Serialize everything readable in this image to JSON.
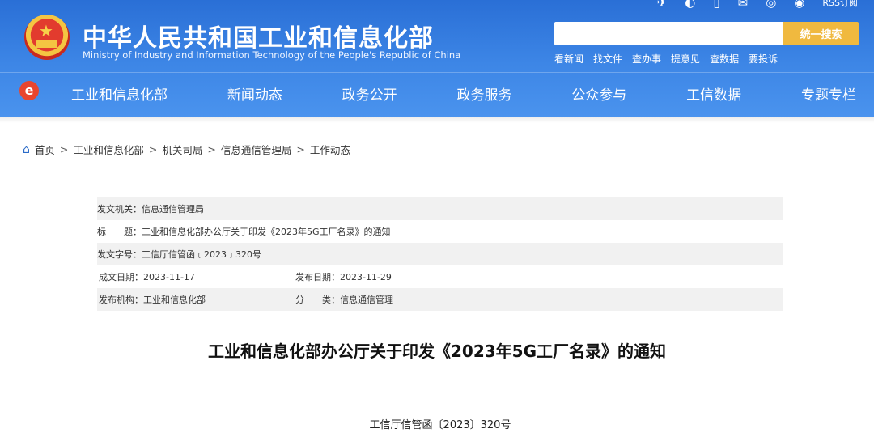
{
  "header": {
    "title": "中华人民共和国工业和信息化部",
    "subtitle": "Ministry of Industry and Information Technology of the People's Republic of China",
    "top_icons": [
      "weibo-icon",
      "wechat-icon",
      "mobile-icon",
      "mail-icon",
      "chat-icon",
      "rss-icon"
    ],
    "rss_label": "RSS订阅",
    "search": {
      "placeholder": "",
      "button": "统一搜索"
    },
    "quick_links": [
      "看新闻",
      "找文件",
      "查办事",
      "提意见",
      "查数据",
      "要投诉"
    ]
  },
  "nav": {
    "logo": "e",
    "items": [
      "工业和信息化部",
      "新闻动态",
      "政务公开",
      "政务服务",
      "公众参与",
      "工信数据",
      "专题专栏"
    ]
  },
  "breadcrumb": [
    "首页",
    "工业和信息化部",
    "机关司局",
    "信息通信管理局",
    "工作动态"
  ],
  "breadcrumb_sep": ">",
  "meta": {
    "issuer_label": "发文机关：",
    "issuer": "信息通信管理局",
    "title_label": "标　　题：",
    "title": "工业和信息化部办公厅关于印发《2023年5G工厂名录》的通知",
    "docno_label": "发文字号：",
    "docno": "工信厅信管函﹝2023﹞320号",
    "created_label": "成文日期：",
    "created": "2023-11-17",
    "published_label": "发布日期：",
    "published": "2023-11-29",
    "org_label": "发布机构：",
    "org": "工业和信息化部",
    "category_label": "分　　类：",
    "category": "信息通信管理"
  },
  "article": {
    "title": "工业和信息化部办公厅关于印发《2023年5G工厂名录》的通知",
    "doc_number": "工信厅信管函〔2023〕320号"
  },
  "colors": {
    "banner": "#3d86e6",
    "search_button": "#f0b93f",
    "nav_logo": "#e8452e",
    "link": "#2b6bc8"
  }
}
